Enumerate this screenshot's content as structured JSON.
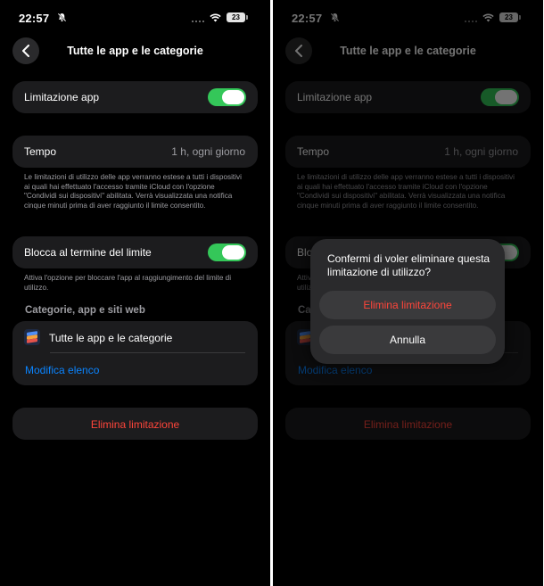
{
  "status": {
    "time": "22:57",
    "battery": "23"
  },
  "nav": {
    "title": "Tutte le app e le categorie"
  },
  "app_limit": {
    "label": "Limitazione app",
    "enabled": true
  },
  "time_row": {
    "label": "Tempo",
    "value": "1 h, ogni giorno"
  },
  "time_footnote": "Le limitazioni di utilizzo delle app verranno estese a tutti i dispositivi ai quali hai effettuato l'accesso tramite iCloud con l'opzione \"Condividi sui dispositivi\" abilitata. Verrà visualizzata una notifica cinque minuti prima di aver raggiunto il limite consentito.",
  "block_limit": {
    "label": "Blocca al termine del limite",
    "enabled": true
  },
  "block_footnote": "Attiva l'opzione per bloccare l'app al raggiungimento del limite di utilizzo.",
  "categories": {
    "header": "Categorie, app e siti web",
    "item_label": "Tutte le app e le categorie",
    "edit_link": "Modifica elenco"
  },
  "delete_label": "Elimina limitazione",
  "dialog": {
    "message": "Confermi di voler eliminare questa limitazione di utilizzo?",
    "confirm_label": "Elimina limitazione",
    "cancel_label": "Annulla"
  },
  "colors": {
    "accent": "#0a84ff",
    "toggle_on": "#34c759",
    "destructive": "#ff453a",
    "card": "#1c1c1e"
  }
}
